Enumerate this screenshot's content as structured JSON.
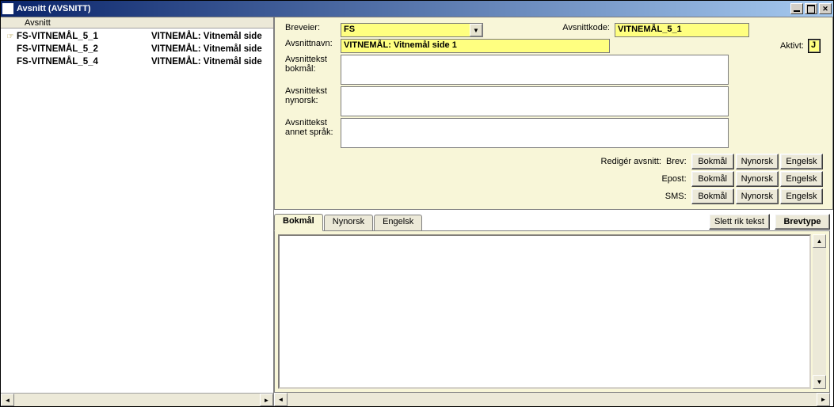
{
  "window": {
    "title": "Avsnitt   (AVSNITT)"
  },
  "left": {
    "header": "Avsnitt",
    "items": [
      {
        "arrow": "☞",
        "code": "FS-VITNEMÅL_5_1",
        "desc": "VITNEMÅL: Vitnemål side"
      },
      {
        "arrow": "",
        "code": "FS-VITNEMÅL_5_2",
        "desc": "VITNEMÅL: Vitnemål side"
      },
      {
        "arrow": "",
        "code": "FS-VITNEMÅL_5_4",
        "desc": "VITNEMÅL: Vitnemål side"
      }
    ]
  },
  "form": {
    "labels": {
      "breveier": "Breveier:",
      "avsnittkode": "Avsnittkode:",
      "avsnittnavn": "Avsnittnavn:",
      "aktivt": "Aktivt:",
      "tekst_bokmal_l1": "Avsnittekst",
      "tekst_bokmal_l2": "bokmål:",
      "tekst_nynorsk_l1": "Avsnittekst",
      "tekst_nynorsk_l2": "nynorsk:",
      "tekst_annet_l1": "Avsnittekst",
      "tekst_annet_l2": "annet språk:"
    },
    "values": {
      "breveier": "FS",
      "avsnittkode": "VITNEMÅL_5_1",
      "avsnittnavn": "VITNEMÅL: Vitnemål side 1",
      "aktivt": "J",
      "tekst_bokmal": "",
      "tekst_nynorsk": "",
      "tekst_annet": ""
    },
    "edit": {
      "rediger_label": "Redigér avsnitt:",
      "brev_label": "Brev:",
      "epost_label": "Epost:",
      "sms_label": "SMS:",
      "bokmal": "Bokmål",
      "nynorsk": "Nynorsk",
      "engelsk": "Engelsk"
    }
  },
  "tabs": {
    "bokmal": "Bokmål",
    "nynorsk": "Nynorsk",
    "engelsk": "Engelsk",
    "slett": "Slett rik tekst",
    "brevtype": "Brevtype"
  }
}
